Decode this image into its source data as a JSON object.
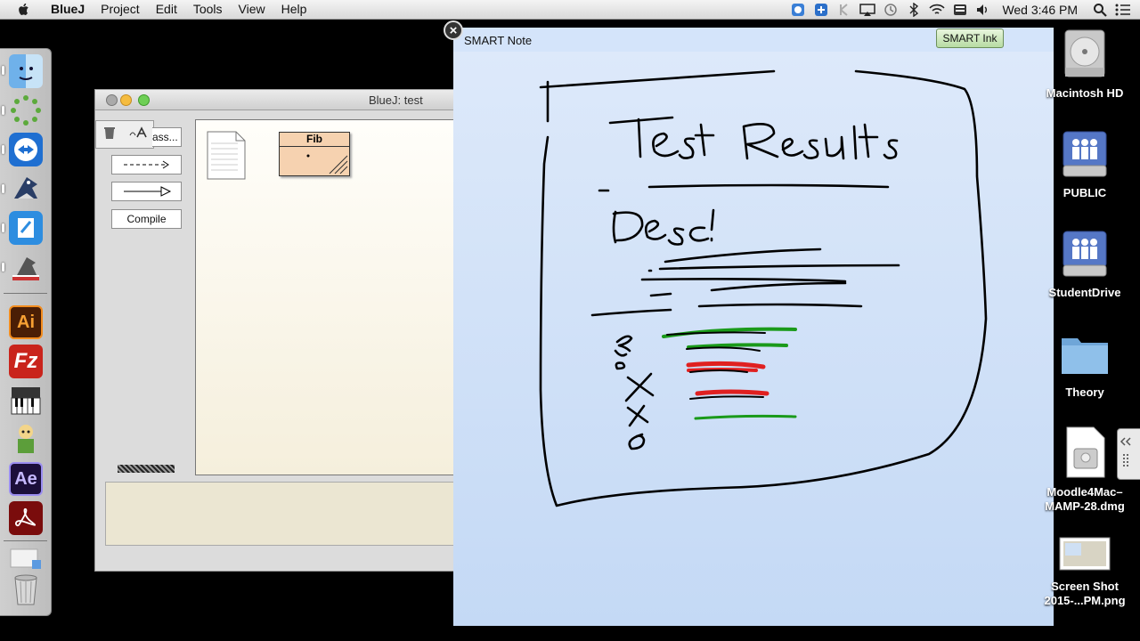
{
  "menubar": {
    "app_name": "BlueJ",
    "items": [
      "Project",
      "Edit",
      "Tools",
      "View",
      "Help"
    ],
    "clock": "Wed 3:46 PM"
  },
  "bluej": {
    "title": "BlueJ:  test",
    "new_class_label": "ass...",
    "compile_label": "Compile",
    "class_name": "Fib"
  },
  "smart_note": {
    "title": "SMART Note",
    "ink_button": "SMART Ink",
    "close_label": "×",
    "handwritten_text": [
      "Test Results",
      "Desc!"
    ]
  },
  "desktop": {
    "icons": [
      {
        "label": "Macintosh HD",
        "icon": "hard-drive-icon"
      },
      {
        "label": "PUBLIC",
        "icon": "network-drive-icon"
      },
      {
        "label": "StudentDrive",
        "icon": "network-drive-icon"
      },
      {
        "label": "Theory",
        "icon": "folder-icon"
      },
      {
        "label": "Moodle4Mac–",
        "label2": "MAMP-28.dmg",
        "icon": "dmg-icon"
      },
      {
        "label": "Screen Shot",
        "label2": "2015-...PM.png",
        "icon": "screenshot-icon"
      }
    ]
  },
  "dock": {
    "items": [
      "finder-icon",
      "loading-icon",
      "teamviewer-icon",
      "bluej-icon",
      "smart-notebook-icon",
      "screen-capture-icon",
      "illustrator-icon",
      "filezilla-icon",
      "piano-icon",
      "character-icon",
      "after-effects-icon",
      "acrobat-icon",
      "preview-icon",
      "trash-icon"
    ],
    "ai_label": "Ai",
    "fz_label": "Fz",
    "ae_label": "Ae"
  }
}
